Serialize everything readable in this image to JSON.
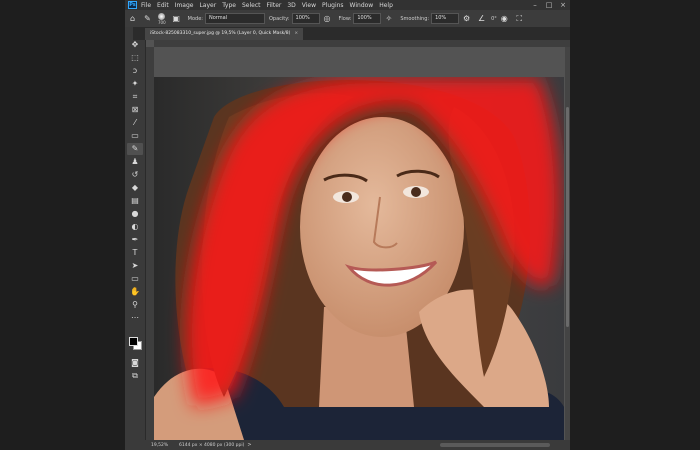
{
  "menubar": {
    "logo": "Ps",
    "items": [
      "File",
      "Edit",
      "Image",
      "Layer",
      "Type",
      "Select",
      "Filter",
      "3D",
      "View",
      "Plugins",
      "Window",
      "Help"
    ]
  },
  "options": {
    "brush_size": "700",
    "mode_label": "Mode:",
    "mode_value": "Normal",
    "opacity_label": "Opacity:",
    "opacity_value": "100%",
    "flow_label": "Flow:",
    "flow_value": "100%",
    "smoothing_label": "Smoothing:",
    "smoothing_value": "10%",
    "angle_value": "0°"
  },
  "document": {
    "tab_title": "iStock-825083310_super.jpg @ 19,5% (Layer 0, Quick Mask/8)",
    "tab_close": "×"
  },
  "status": {
    "zoom": "19,52%",
    "doc_info": "6144 px × 4080 px (300 ppi)",
    "arrow": ">"
  },
  "colors": {
    "quick_mask": "#ff1a1a",
    "panel_bg": "#535353",
    "accent": "#31a8ff"
  }
}
